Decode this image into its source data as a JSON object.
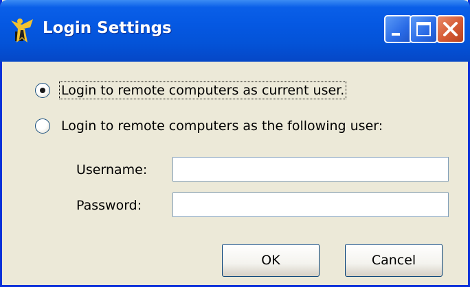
{
  "window": {
    "title": "Login Settings",
    "controls": {
      "minimize": "minimize-icon",
      "maximize": "maximize-icon",
      "close": "close-icon"
    }
  },
  "options": [
    {
      "label": "Login to remote computers as current user.",
      "selected": true
    },
    {
      "label": "Login to remote computers as the following user:",
      "selected": false
    }
  ],
  "fields": {
    "username": {
      "label": "Username:",
      "value": ""
    },
    "password": {
      "label": "Password:",
      "value": ""
    }
  },
  "buttons": {
    "ok": "OK",
    "cancel": "Cancel"
  },
  "colors": {
    "titlebar": "#0558E2",
    "face": "#ECE9D8",
    "border": "#0831D9",
    "close": "#D55A34"
  }
}
